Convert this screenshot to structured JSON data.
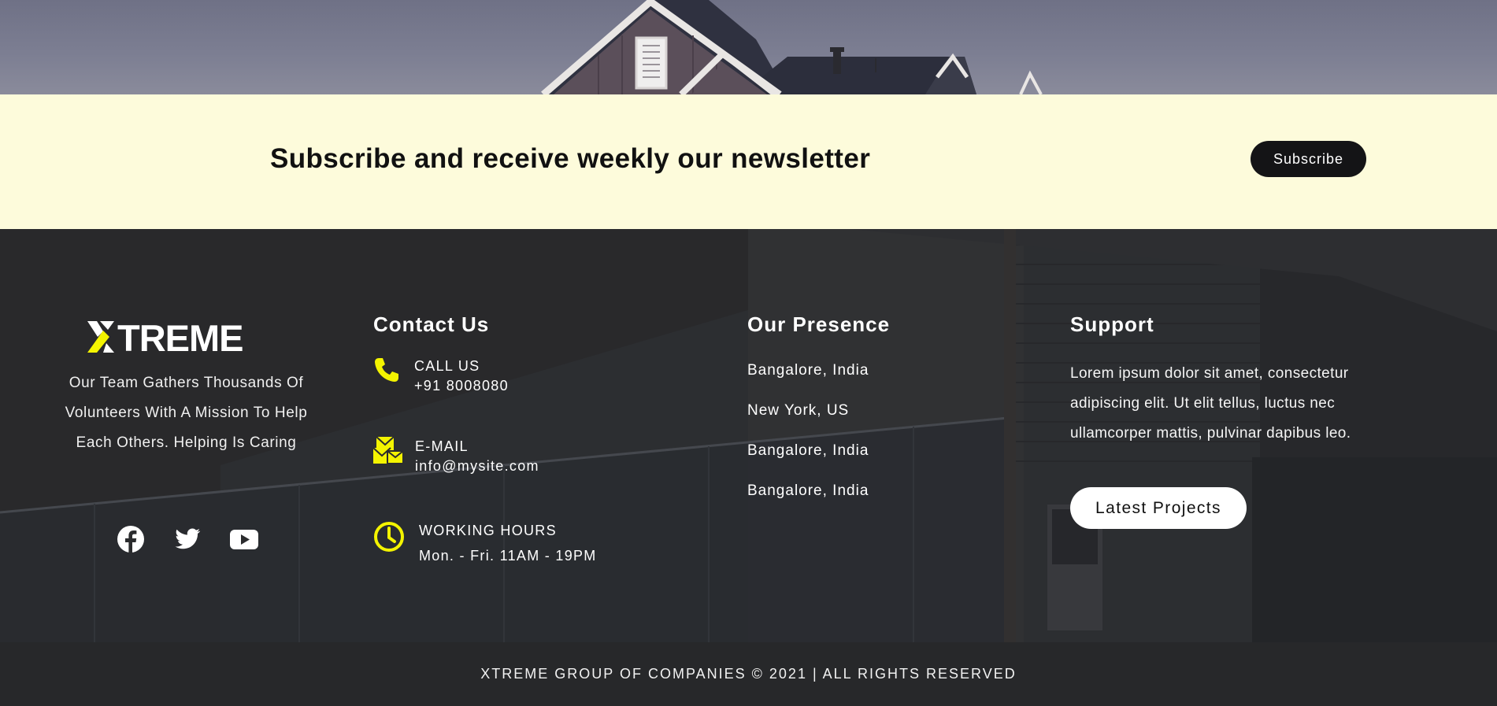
{
  "newsletter": {
    "title": "Subscribe and receive weekly our newsletter",
    "button_label": "Subscribe"
  },
  "brand": {
    "logo_text": "XTREME",
    "tagline_lines": [
      "Our Team Gathers Thousands Of",
      "Volunteers With A Mission To Help",
      "Each Others. Helping Is Caring"
    ],
    "social_icons": [
      "facebook-icon",
      "twitter-icon",
      "youtube-icon"
    ]
  },
  "contact": {
    "heading": "Contact Us",
    "items": [
      {
        "icon": "phone-icon",
        "label": "CALL US",
        "value": "+91 8008080"
      },
      {
        "icon": "mail-icon",
        "label": "E-MAIL",
        "value": "info@mysite.com"
      },
      {
        "icon": "clock-icon",
        "label": "WORKING HOURS",
        "value": "Mon. - Fri. 11AM - 19PM"
      }
    ]
  },
  "presence": {
    "heading": "Our Presence",
    "locations": [
      "Bangalore, India",
      "New York, US",
      "Bangalore, India",
      "Bangalore, India"
    ]
  },
  "support": {
    "heading": "Support",
    "text": "Lorem ipsum dolor sit amet, consectetur adipiscing elit. Ut elit tellus, luctus nec ullamcorper mattis, pulvinar dapibus leo.",
    "button_label": "Latest Projects"
  },
  "copyright": {
    "text": "XTREME GROUP OF COMPANIES © 2021 | ALL RIGHTS RESERVED"
  },
  "colors": {
    "accent": "#f4f400",
    "newsletter_bg": "#fdfbdb",
    "footer_bg": "#2b2c2e",
    "button_dark": "#141416"
  }
}
